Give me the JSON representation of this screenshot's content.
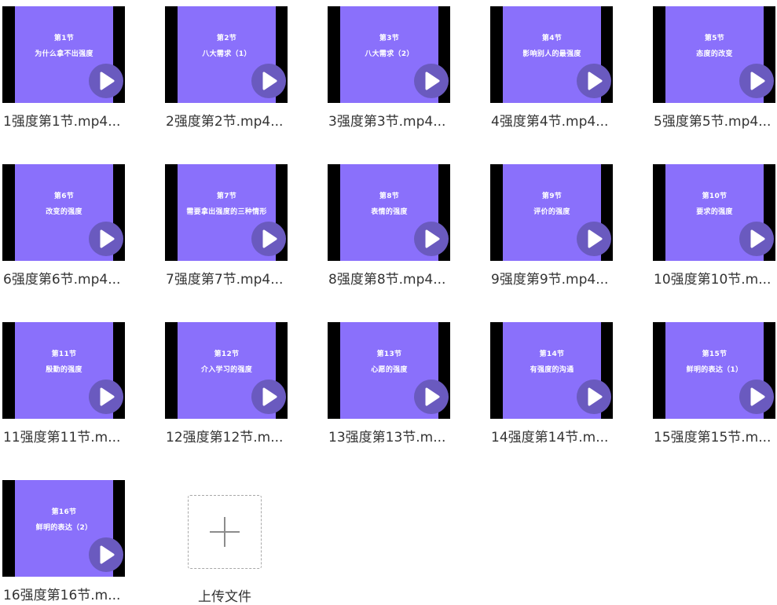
{
  "files": [
    {
      "lesson": "第1节",
      "topic": "为什么拿不出强度",
      "name": "1强度第1节.mp4..."
    },
    {
      "lesson": "第2节",
      "topic": "八大需求（1）",
      "name": "2强度第2节.mp4..."
    },
    {
      "lesson": "第3节",
      "topic": "八大需求（2）",
      "name": "3强度第3节.mp4..."
    },
    {
      "lesson": "第4节",
      "topic": "影响别人的最强度",
      "name": "4强度第4节.mp4..."
    },
    {
      "lesson": "第5节",
      "topic": "态度的改变",
      "name": "5强度第5节.mp4..."
    },
    {
      "lesson": "第6节",
      "topic": "改变的强度",
      "name": "6强度第6节.mp4..."
    },
    {
      "lesson": "第7节",
      "topic": "需要拿出强度的三种情形",
      "name": "7强度第7节.mp4..."
    },
    {
      "lesson": "第8节",
      "topic": "表情的强度",
      "name": "8强度第8节.mp4..."
    },
    {
      "lesson": "第9节",
      "topic": "评价的强度",
      "name": "9强度第9节.mp4..."
    },
    {
      "lesson": "第10节",
      "topic": "要求的强度",
      "name": "10强度第10节.m..."
    },
    {
      "lesson": "第11节",
      "topic": "殷勤的强度",
      "name": "11强度第11节.m..."
    },
    {
      "lesson": "第12节",
      "topic": "介入学习的强度",
      "name": "12强度第12节.m..."
    },
    {
      "lesson": "第13节",
      "topic": "心愿的强度",
      "name": "13强度第13节.m..."
    },
    {
      "lesson": "第14节",
      "topic": "有强度的沟通",
      "name": "14强度第14节.m..."
    },
    {
      "lesson": "第15节",
      "topic": "鲜明的表达（1）",
      "name": "15强度第15节.m..."
    },
    {
      "lesson": "第16节",
      "topic": "鲜明的表达（2）",
      "name": "16强度第16节.m..."
    }
  ],
  "upload": {
    "label": "上传文件",
    "icon": "plus-icon"
  },
  "colors": {
    "thumbnail_bg": "#8a70fb",
    "letterbox": "#000000",
    "play_button": "#6a5abf",
    "text": "#333333"
  }
}
